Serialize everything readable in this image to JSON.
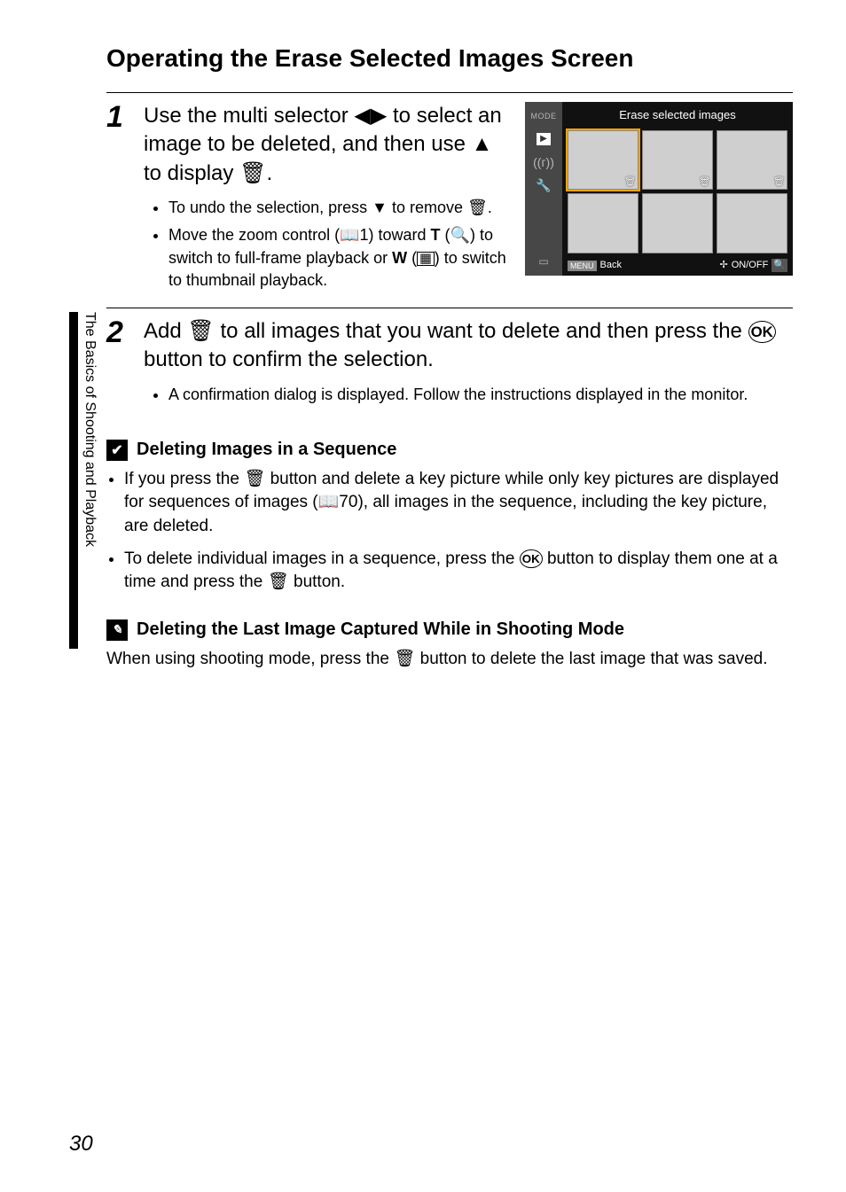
{
  "title": "Operating the Erase Selected Images Screen",
  "sidetab": "The Basics of Shooting and Playback",
  "pagenum": "30",
  "step1": {
    "num": "1",
    "main_a": "Use the multi selector ",
    "main_b": " to select an image to be deleted, and then use ",
    "main_c": " to display ",
    "main_d": ".",
    "bullet1_a": "To undo the selection, press ",
    "bullet1_b": " to remove ",
    "bullet1_c": ".",
    "bullet2_a": "Move the zoom control (",
    "bullet2_ref": "1",
    "bullet2_b": ") toward ",
    "bullet2_t": "T",
    "bullet2_c": " (",
    "bullet2_d": ") to switch to full-frame playback or ",
    "bullet2_w": "W",
    "bullet2_e": " (",
    "bullet2_f": ") to switch to thumbnail playback."
  },
  "screen": {
    "title": "Erase selected images",
    "back": "Back",
    "onoff": "ON/OFF",
    "mode": "MODE"
  },
  "step2": {
    "num": "2",
    "main_a": "Add ",
    "main_b": " to all images that you want to delete and then press the ",
    "main_c": " button to confirm the selection.",
    "bullet": "A confirmation dialog is displayed. Follow the instructions displayed in the monitor."
  },
  "noteA": {
    "title": "Deleting Images in a Sequence",
    "b1_a": "If you press the ",
    "b1_b": " button and delete a key picture while only key pictures are displayed for sequences of images (",
    "b1_ref": "70",
    "b1_c": "), all images in the sequence, including the key picture, are deleted.",
    "b2_a": "To delete individual images in a sequence, press the ",
    "b2_b": " button to display them one at a time and press the ",
    "b2_c": " button."
  },
  "noteB": {
    "title": "Deleting the Last Image Captured While in Shooting Mode",
    "body_a": "When using shooting mode, press the ",
    "body_b": " button to delete the last image that was saved."
  }
}
